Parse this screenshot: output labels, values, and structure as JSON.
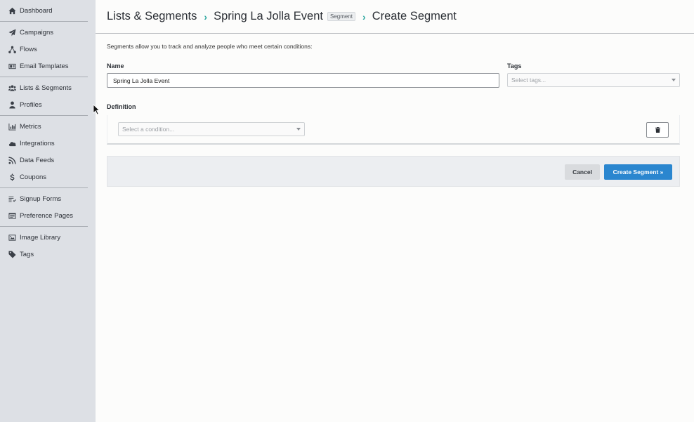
{
  "sidebar": {
    "groups": [
      [
        {
          "label": "Dashboard",
          "icon": "home-icon"
        }
      ],
      [
        {
          "label": "Campaigns",
          "icon": "paper-plane-icon"
        },
        {
          "label": "Flows",
          "icon": "flow-icon"
        },
        {
          "label": "Email Templates",
          "icon": "email-template-icon"
        }
      ],
      [
        {
          "label": "Lists & Segments",
          "icon": "users-icon"
        },
        {
          "label": "Profiles",
          "icon": "user-icon"
        }
      ],
      [
        {
          "label": "Metrics",
          "icon": "bar-chart-icon"
        },
        {
          "label": "Integrations",
          "icon": "cloud-icon"
        },
        {
          "label": "Data Feeds",
          "icon": "rss-icon"
        },
        {
          "label": "Coupons",
          "icon": "dollar-icon"
        }
      ],
      [
        {
          "label": "Signup Forms",
          "icon": "list-icon"
        },
        {
          "label": "Preference Pages",
          "icon": "form-icon"
        }
      ],
      [
        {
          "label": "Image Library",
          "icon": "image-icon"
        },
        {
          "label": "Tags",
          "icon": "tag-icon"
        }
      ]
    ]
  },
  "breadcrumb": {
    "root": "Lists & Segments",
    "parent": "Spring La Jolla Event",
    "parent_badge": "Segment",
    "current": "Create Segment",
    "separator": "›"
  },
  "form": {
    "intro": "Segments allow you to track and analyze people who meet certain conditions:",
    "name_label": "Name",
    "name_value": "Spring La Jolla Event",
    "tags_label": "Tags",
    "tags_placeholder": "Select tags...",
    "definition_label": "Definition",
    "condition_placeholder": "Select a condition..."
  },
  "actions": {
    "cancel": "Cancel",
    "create": "Create Segment »"
  },
  "colors": {
    "sidebar_bg": "#dde0e5",
    "accent_teal": "#2fa8a0",
    "primary_button": "#2a86cf"
  }
}
